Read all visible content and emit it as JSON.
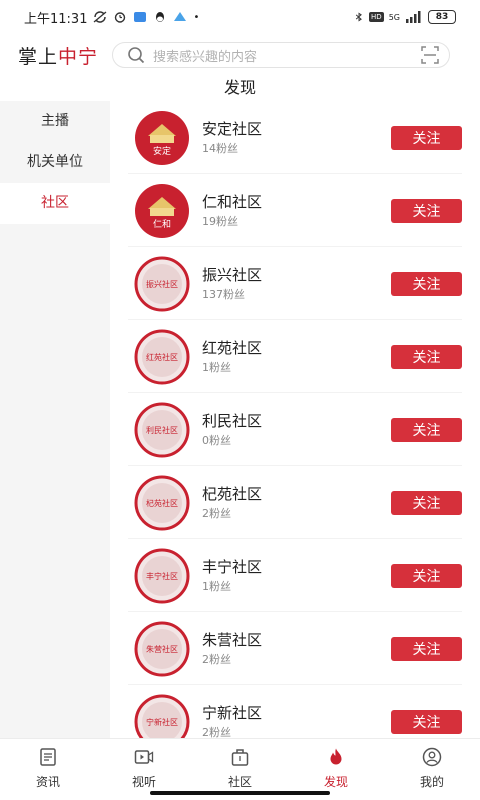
{
  "status_bar": {
    "time": "上午11:31",
    "network_label": "5G",
    "battery": "83"
  },
  "header": {
    "brand_part1": "掌上",
    "brand_part2": "中宁",
    "search_placeholder": "搜索感兴趣的内容"
  },
  "page_title": "发现",
  "sidebar": {
    "items": [
      {
        "label": "主播",
        "active": false
      },
      {
        "label": "机关单位",
        "active": false
      },
      {
        "label": "社区",
        "active": true
      }
    ]
  },
  "communities": [
    {
      "name": "安定社区",
      "fans": "14粉丝",
      "badge": "安定",
      "follow": "关注"
    },
    {
      "name": "仁和社区",
      "fans": "19粉丝",
      "badge": "仁和",
      "follow": "关注"
    },
    {
      "name": "振兴社区",
      "fans": "137粉丝",
      "badge": "振兴社区",
      "follow": "关注"
    },
    {
      "name": "红苑社区",
      "fans": "1粉丝",
      "badge": "红苑社区",
      "follow": "关注"
    },
    {
      "name": "利民社区",
      "fans": "0粉丝",
      "badge": "利民社区",
      "follow": "关注"
    },
    {
      "name": "杞苑社区",
      "fans": "2粉丝",
      "badge": "杞苑社区",
      "follow": "关注"
    },
    {
      "name": "丰宁社区",
      "fans": "1粉丝",
      "badge": "丰宁社区",
      "follow": "关注"
    },
    {
      "name": "朱营社区",
      "fans": "2粉丝",
      "badge": "朱营社区",
      "follow": "关注"
    },
    {
      "name": "宁新社区",
      "fans": "2粉丝",
      "badge": "宁新社区",
      "follow": "关注"
    }
  ],
  "bottom_nav": [
    {
      "label": "资讯",
      "icon": "news-icon",
      "active": false
    },
    {
      "label": "视听",
      "icon": "video-icon",
      "active": false
    },
    {
      "label": "社区",
      "icon": "community-icon",
      "active": false
    },
    {
      "label": "发现",
      "icon": "flame-icon",
      "active": true
    },
    {
      "label": "我的",
      "icon": "profile-icon",
      "active": false
    }
  ],
  "colors": {
    "accent": "#c8212f",
    "button": "#d6303b",
    "sidebar_bg": "#f5f5f5"
  }
}
